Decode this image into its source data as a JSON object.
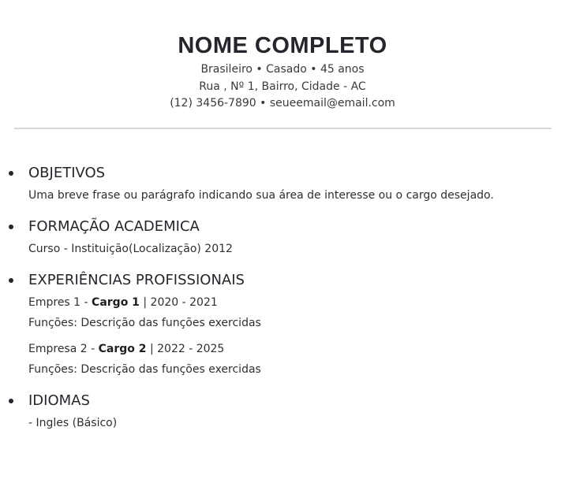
{
  "header": {
    "name": "NOME COMPLETO",
    "personal": "Brasileiro • Casado • 45 anos",
    "address": "Rua , Nº 1, Bairro, Cidade - AC",
    "contact": "(12) 3456-7890 • seueemail@email.com"
  },
  "objectives": {
    "title": "OBJETIVOS",
    "text": "Uma breve frase ou parágrafo indicando sua área de interesse ou o cargo desejado."
  },
  "education": {
    "title": "FORMAÇÃO ACADEMICA",
    "text": "Curso - Instituição(Localização) 2012"
  },
  "experience": {
    "title": "EXPERIÊNCIAS PROFISSIONAIS",
    "jobs": [
      {
        "company": "Empres 1 - ",
        "role": "Cargo 1",
        "period": " | 2020 - 2021",
        "duties": "Funções: Descrição das funções exercidas"
      },
      {
        "company": "Empresa 2 - ",
        "role": "Cargo 2",
        "period": " | 2022 - 2025",
        "duties": "Funções: Descrição das funções exercidas"
      }
    ]
  },
  "languages": {
    "title": "IDIOMAS",
    "text": "- Ingles (Básico)"
  }
}
